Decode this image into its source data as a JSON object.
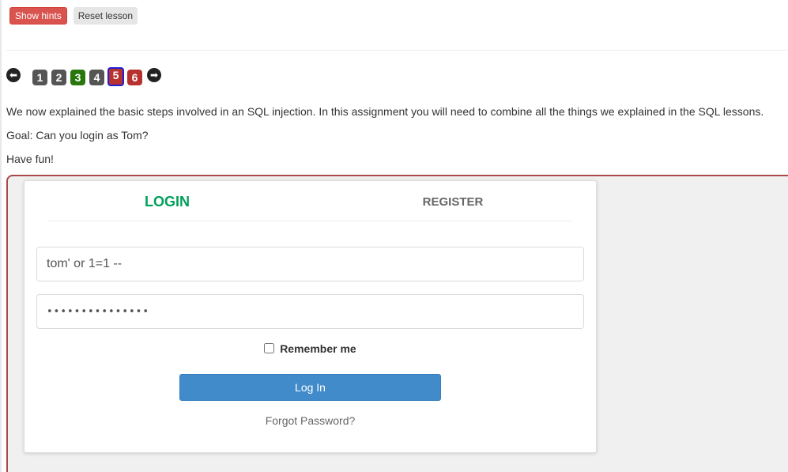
{
  "toolbar": {
    "show_hints_label": "Show hints",
    "reset_lesson_label": "Reset lesson"
  },
  "pager": {
    "pages": [
      {
        "label": "1",
        "color": "#555555",
        "state": "visited"
      },
      {
        "label": "2",
        "color": "#555555",
        "state": "visited"
      },
      {
        "label": "3",
        "color": "#29760c",
        "state": "solved"
      },
      {
        "label": "4",
        "color": "#555555",
        "state": "visited"
      },
      {
        "label": "5",
        "color": "#b7312f",
        "state": "current"
      },
      {
        "label": "6",
        "color": "#b7312f",
        "state": "unsolved"
      }
    ],
    "prev_icon": "left-arrow-circle-icon",
    "next_icon": "right-arrow-circle-icon"
  },
  "lesson": {
    "intro": "We now explained the basic steps involved in an SQL injection. In this assignment you will need to combine all the things we explained in the SQL lessons.",
    "goal": "Goal: Can you login as Tom?",
    "fun": "Have fun!"
  },
  "login_form": {
    "tab_login": "LOGIN",
    "tab_register": "REGISTER",
    "username_value": "tom' or 1=1 --",
    "password_value": "•••••••••••••••",
    "remember_label": "Remember me",
    "remember_checked": false,
    "login_button": "Log In",
    "forgot_link": "Forgot Password?"
  },
  "colors": {
    "accent_green": "#029f5b",
    "hints_red": "#d9534f",
    "primary_blue": "#428bca",
    "lesson_border": "#a94a4a"
  }
}
